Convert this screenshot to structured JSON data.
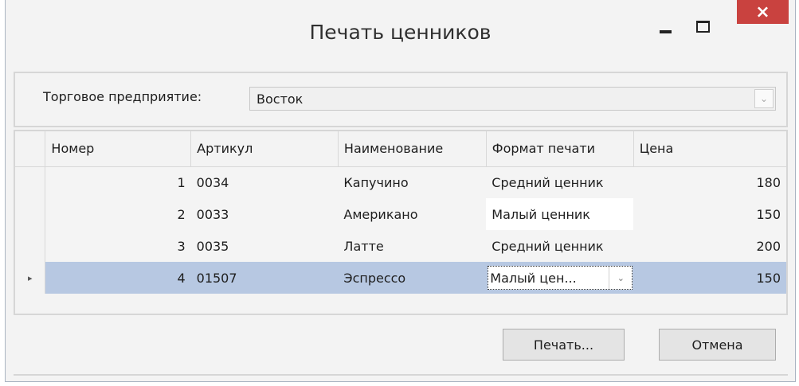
{
  "window": {
    "title": "Печать ценников",
    "close_glyph": "×"
  },
  "store": {
    "label": "Торговое предприятие:",
    "value": "Восток"
  },
  "table": {
    "headers": [
      "Номер",
      "Артикул",
      "Наименование",
      "Формат печати",
      "Цена"
    ],
    "rows": [
      {
        "number": "1",
        "article": "0034",
        "name": "Капучино",
        "format": "Средний ценник",
        "price": "180"
      },
      {
        "number": "2",
        "article": "0033",
        "name": "Американо",
        "format": "Малый ценник",
        "price": "150"
      },
      {
        "number": "3",
        "article": "0035",
        "name": "Латте",
        "format": "Средний ценник",
        "price": "200"
      },
      {
        "number": "4",
        "article": "01507",
        "name": "Эспрессо",
        "format": "Малый цен...",
        "price": "150"
      }
    ],
    "selected_row_marker": "▸"
  },
  "buttons": {
    "print": "Печать...",
    "cancel": "Отмена"
  },
  "colors": {
    "close_button": "#c9423f",
    "selected_row": "#b7c8e2"
  },
  "icons": {
    "dropdown": "chevron-down-icon",
    "row_marker": "row-pointer-icon"
  }
}
